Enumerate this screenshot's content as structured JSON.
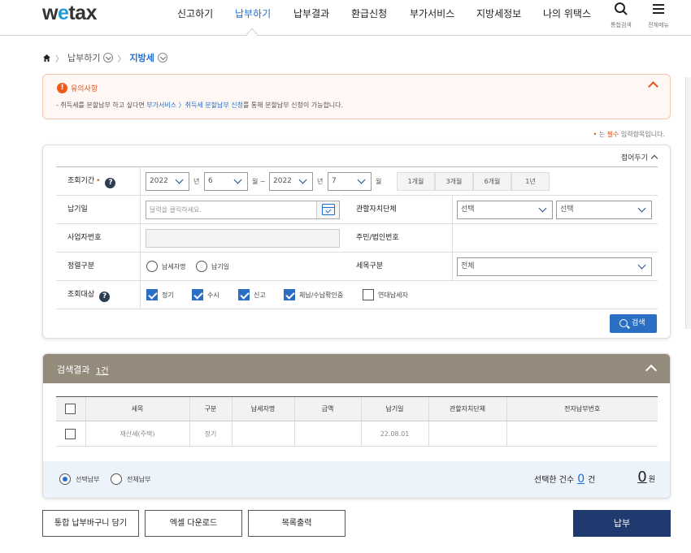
{
  "header": {
    "logo_w": "w",
    "logo_e": "e",
    "logo_rest": "tax",
    "nav": [
      {
        "label": "신고하기",
        "active": false
      },
      {
        "label": "납부하기",
        "active": true
      },
      {
        "label": "납부결과",
        "active": false
      },
      {
        "label": "환급신청",
        "active": false
      },
      {
        "label": "부가서비스",
        "active": false
      },
      {
        "label": "지방세정보",
        "active": false
      },
      {
        "label": "나의 위택스",
        "active": false
      }
    ],
    "search_label": "통합검색",
    "menu_label": "전체메뉴"
  },
  "breadcrumb": {
    "items": [
      "납부하기",
      "지방세"
    ]
  },
  "notice": {
    "title": "유의사항",
    "msg_prefix": "- 취득세를 분할납부 하고 싶다면 ",
    "msg_link": "부가서비스 〉취득세 분할납부 신청",
    "msg_suffix": "를 통해 분할납부 신청이 가능합니다."
  },
  "required_note": {
    "dot": "•",
    "text_prefix": " 는 ",
    "text_hl": "필수",
    "text_suffix": " 입력항목입니다."
  },
  "search": {
    "fold_label": "접어두기",
    "period_label": "조회기간",
    "period_required": "•",
    "help": "?",
    "from_year": "2022",
    "from_month": "6",
    "to_year": "2022",
    "to_month": "7",
    "unit_year": "년",
    "unit_month_tilde": "월 ~",
    "unit_month": "월",
    "quick": [
      "1개월",
      "3개월",
      "6개월",
      "1년"
    ],
    "due_label": "납기일",
    "due_placeholder": "달력을 클릭하세요.",
    "auth_label": "관할자치단체",
    "auth_select1": "선택",
    "auth_select2": "선택",
    "bizno_label": "사업자번호",
    "resno_label": "주민/법인번호",
    "sort_label": "정렬구분",
    "sort_options": [
      "납세자명",
      "납기일"
    ],
    "taxitem_label": "세목구분",
    "taxitem_value": "전체",
    "target_label": "조회대상",
    "targets": [
      {
        "label": "정기",
        "checked": true
      },
      {
        "label": "수시",
        "checked": true
      },
      {
        "label": "신고",
        "checked": true
      },
      {
        "label": "체납/수납확인중",
        "checked": true
      },
      {
        "label": "연대납세자",
        "checked": false
      }
    ],
    "search_button": "검색"
  },
  "results": {
    "title": "검색결과",
    "count": "1건",
    "columns": [
      "세목",
      "구분",
      "납세자명",
      "금액",
      "납기일",
      "관할자치단체",
      "전자납부번호"
    ],
    "rows": [
      {
        "item": "재산세(주택)",
        "type": "정기",
        "taxpayer": "",
        "amount": "",
        "due": "22.08.01",
        "authority": "",
        "epay_no": ""
      }
    ],
    "pay_options": [
      "선택납부",
      "전체납부"
    ],
    "selected_label": "선택한 건수",
    "selected_count": "0",
    "selected_unit": "건",
    "amount_value": "0",
    "amount_unit": "원"
  },
  "actions": {
    "cart": "통합 납부바구니 담기",
    "excel": "엑셀 다운로드",
    "print": "목록출력",
    "pay": "납부"
  },
  "colors": {
    "accent": "#1f6fd1",
    "warn": "#e0541c",
    "result_header": "#948b7c",
    "pay_button": "#1e3a6e"
  }
}
